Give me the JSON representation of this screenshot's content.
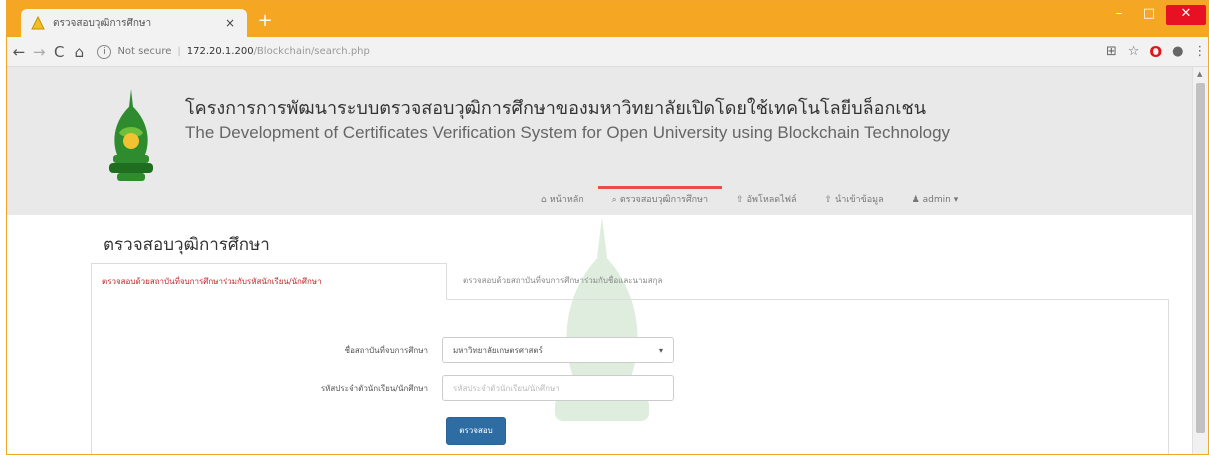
{
  "browser": {
    "tab_title": "ตรวจสอบวุฒิการศึกษา",
    "tab_close": "×",
    "new_tab": "+",
    "url_security": "Not secure",
    "url_host": "172.20.1.200",
    "url_path": "/Blockchain/search.php",
    "window_controls": {
      "minimize": "–",
      "maximize": "□",
      "close": "✕"
    }
  },
  "header": {
    "title_th": "โครงการการพัฒนาระบบตรวจสอบวุฒิการศึกษาของมหาวิทยาลัยเปิดโดยใช้เทคโนโลยีบล็อกเชน",
    "title_en": "The Development of Certificates Verification System for Open University using Blockchain Technology",
    "logo_color": "#2e8b2e"
  },
  "nav": {
    "items": [
      {
        "icon": "home-icon",
        "label": "หน้าหลัก"
      },
      {
        "icon": "search-icon",
        "label": "ตรวจสอบวุฒิการศึกษา",
        "active": true
      },
      {
        "icon": "upload-icon",
        "label": "อัพโหลดไฟล์"
      },
      {
        "icon": "upload-icon",
        "label": "นำเข้าข้อมูล"
      },
      {
        "icon": "user-icon",
        "label": "admin ▾"
      }
    ],
    "active_color": "#e84c4c"
  },
  "page": {
    "title": "ตรวจสอบวุฒิการศึกษา",
    "tabs": [
      {
        "label": "ตรวจสอบด้วยสถาบันที่จบการศึกษาร่วมกับรหัสนักเรียน/นักศึกษา",
        "active": true
      },
      {
        "label": "ตรวจสอบด้วยสถาบันที่จบการศึกษาร่วมกับชื่อและนามสกุล",
        "active": false
      }
    ],
    "form": {
      "institution_label": "ชื่อสถาบันที่จบการศึกษา",
      "institution_value": "มหาวิทยาลัยเกษตรศาสตร์",
      "student_id_label": "รหัสประจำตัวนักเรียน/นักศึกษา",
      "student_id_placeholder": "รหัสประจำตัวนักเรียน/นักศึกษา",
      "submit_label": "ตรวจสอบ"
    },
    "accent_color": "#c0282d",
    "button_color": "#2e6da4"
  }
}
